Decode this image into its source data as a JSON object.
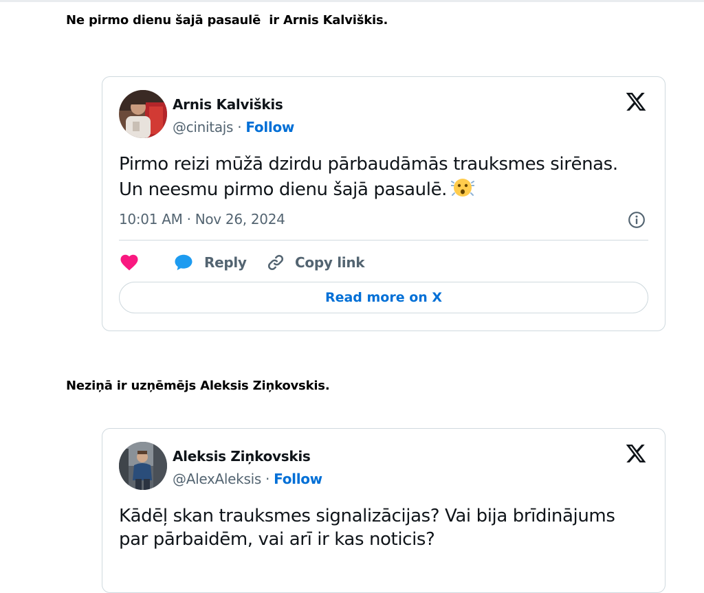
{
  "paragraphs": [
    "Ne pirmo dienu šajā pasaulē  ir Arnis Kalviškis.",
    "Neziņā ir uzņēmējs Aleksis Ziņkovskis."
  ],
  "tweets": [
    {
      "name": "Arnis Kalviškis",
      "handle": "@cinitajs",
      "separator": "·",
      "follow": "Follow",
      "text_lines": [
        "Pirmo reizi mūžā dzirdu pārbaudāmās trauksmes sirēnas.",
        "Un neesmu pirmo dienu šajā pasaulē."
      ],
      "emoji": "hushed-face-emoji",
      "timestamp": "10:01 AM · Nov 26, 2024",
      "actions": {
        "reply": "Reply",
        "copy": "Copy link"
      },
      "read_more": "Read more on X"
    },
    {
      "name": "Aleksis Ziņkovskis",
      "handle": "@AlexAleksis",
      "separator": "·",
      "follow": "Follow",
      "text_lines": [
        "Kādēļ skan trauksmes signalizācijas? Vai bija brīdinājums",
        "par pārbaidēm, vai arī ir kas noticis?"
      ]
    }
  ],
  "colors": {
    "accent": "#006fd6",
    "heart": "#f91880",
    "reply_bubble": "#1d9bf0",
    "muted": "#536471",
    "border": "#cfd9de"
  },
  "icons": [
    "x-logo-icon",
    "info-icon",
    "heart-icon",
    "reply-bubble-icon",
    "link-icon"
  ]
}
